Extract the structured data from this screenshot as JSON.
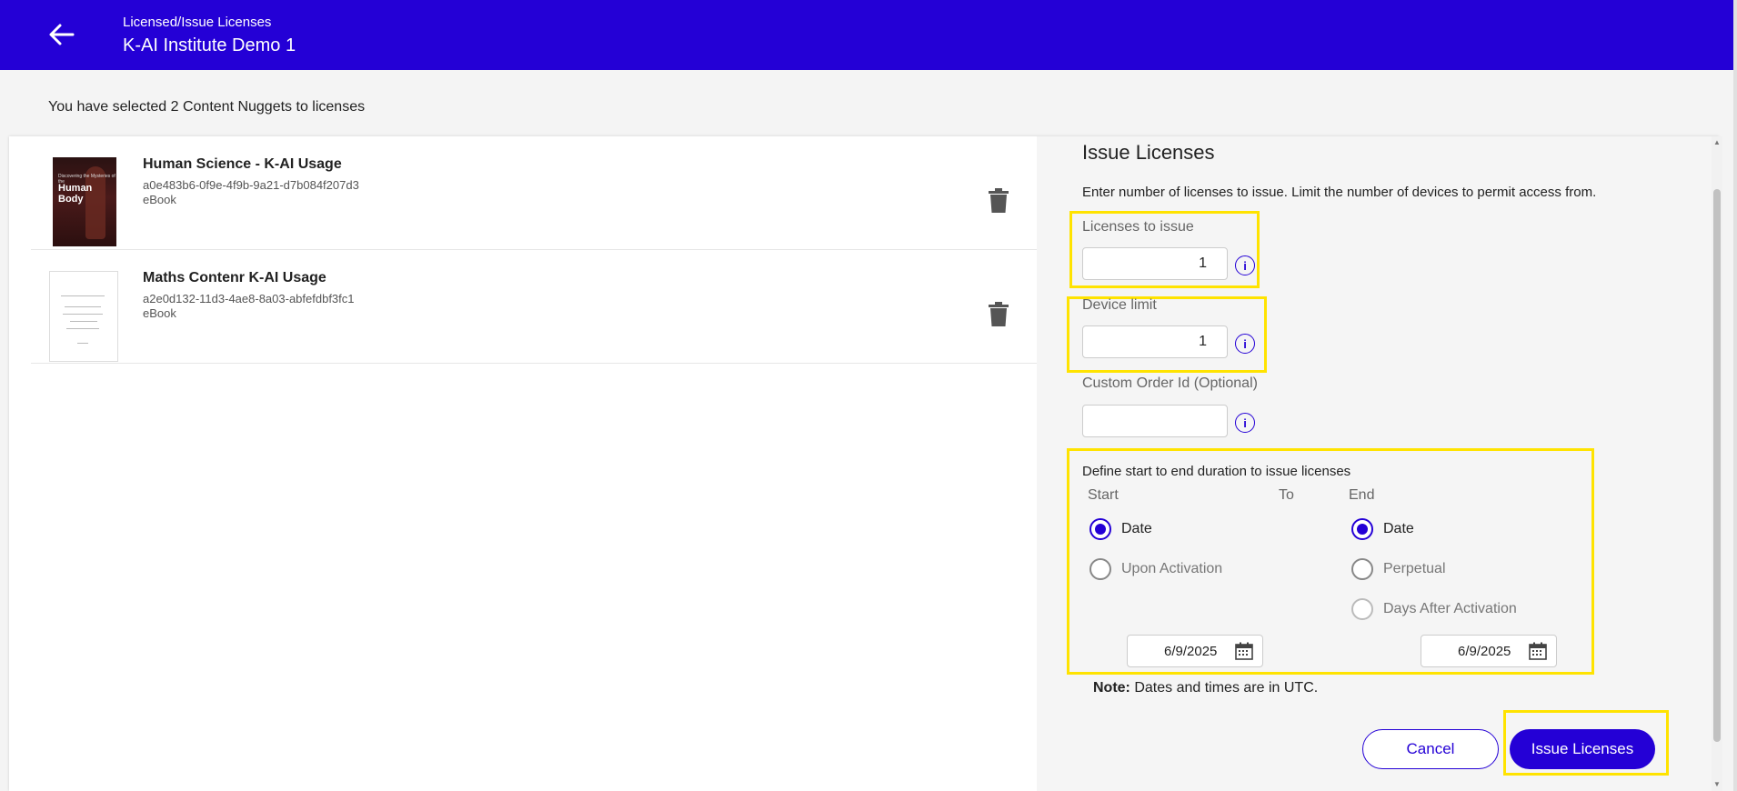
{
  "header": {
    "breadcrumb": "Licensed/Issue Licenses",
    "title": "K-AI Institute Demo 1",
    "back_icon": "arrow-left-icon"
  },
  "selection_text": "You have selected 2 Content Nuggets to licenses",
  "items": [
    {
      "title": "Human Science - K-AI Usage",
      "id": "a0e483b6-0f9e-4f9b-9a21-d7b084f207d3",
      "type": "eBook",
      "cover_text_small": "Discovering the Mysteries of the",
      "cover_text_big": "Human Body"
    },
    {
      "title": "Maths Contenr K-AI Usage",
      "id": "a2e0d132-11d3-4ae8-8a03-abfefdbf3fc1",
      "type": "eBook"
    }
  ],
  "form": {
    "title": "Issue Licenses",
    "description": "Enter number of licenses to issue. Limit the number of devices to permit access from.",
    "licenses_label": "Licenses to issue",
    "licenses_value": "1",
    "device_limit_label": "Device limit",
    "device_limit_value": "1",
    "order_id_label": "Custom Order Id (Optional)",
    "order_id_value": "",
    "info_icon": "i",
    "duration_title": "Define start to end duration to issue licenses",
    "start_label": "Start",
    "to_label": "To",
    "end_label": "End",
    "start_options": [
      {
        "label": "Date",
        "selected": true
      },
      {
        "label": "Upon Activation",
        "selected": false
      }
    ],
    "end_options": [
      {
        "label": "Date",
        "selected": true
      },
      {
        "label": "Perpetual",
        "selected": false
      },
      {
        "label": "Days After Activation",
        "selected": false
      }
    ],
    "start_date": "6/9/2025",
    "end_date": "6/9/2025",
    "note_bold": "Note:",
    "note_text": " Dates and times are in UTC.",
    "cancel_label": "Cancel",
    "issue_label": "Issue Licenses"
  },
  "colors": {
    "brand": "#2400d6",
    "highlight": "#ffe300"
  }
}
